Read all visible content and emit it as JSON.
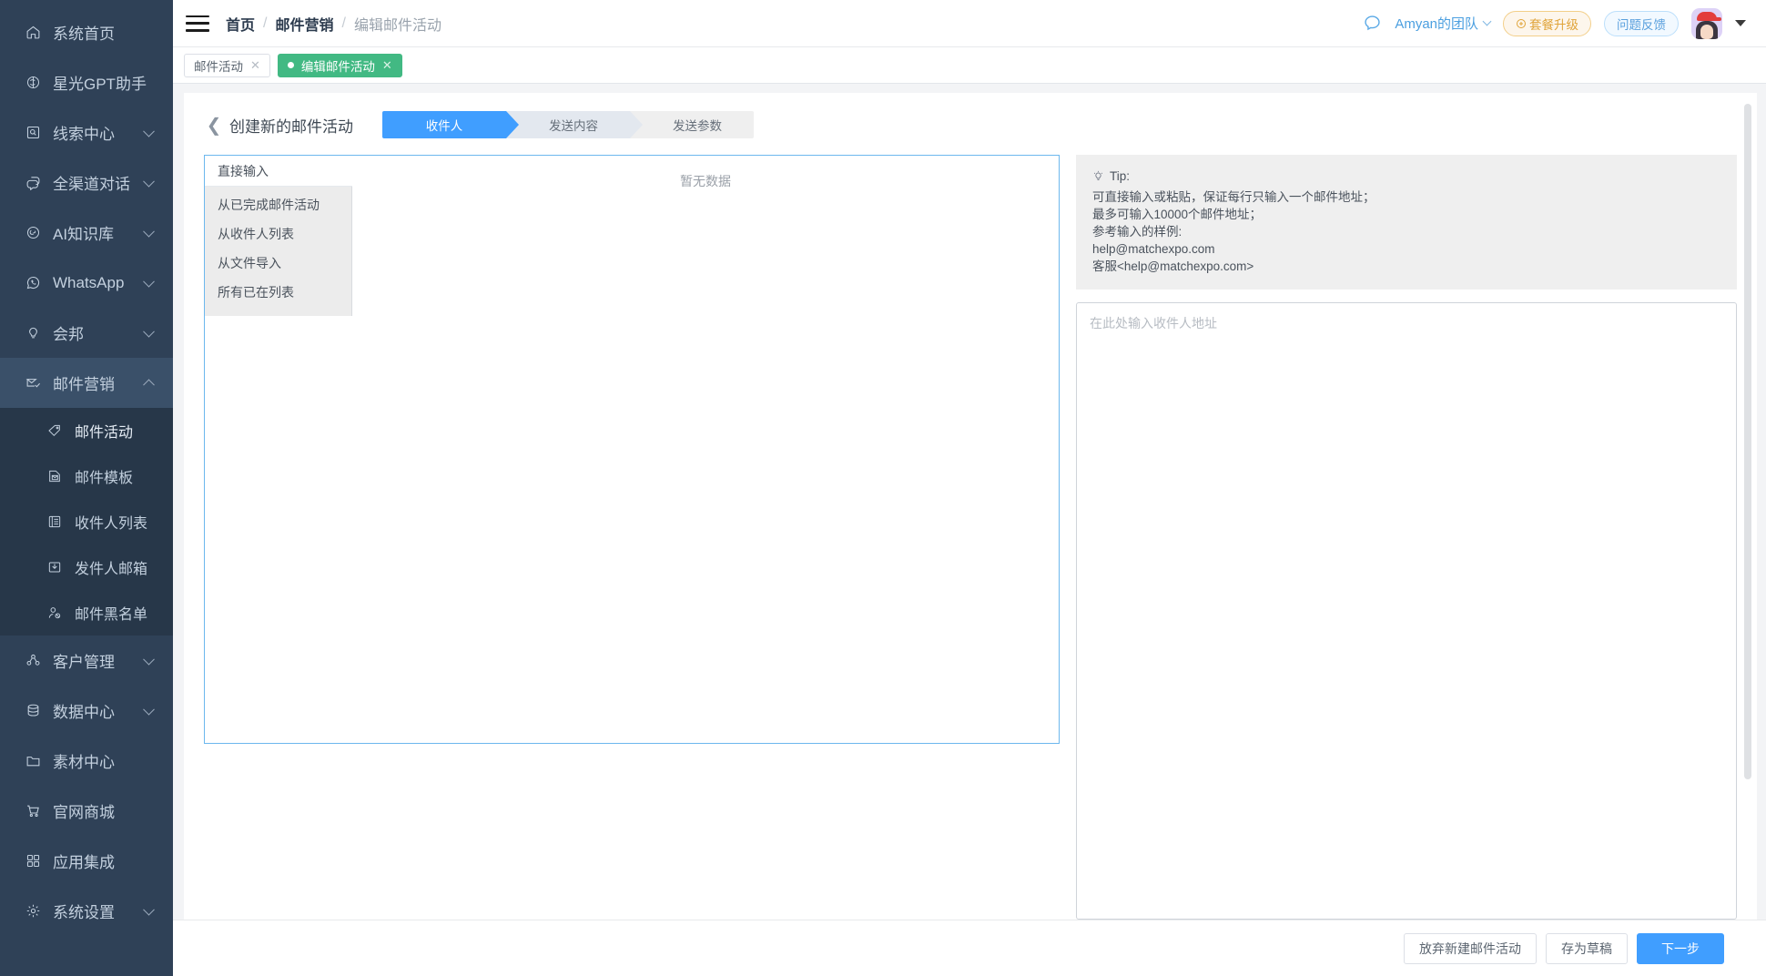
{
  "sidebar": {
    "items": [
      {
        "icon": "home-icon",
        "label": "系统首页",
        "chevron": false
      },
      {
        "icon": "gpt-icon",
        "label": "星光GPT助手",
        "chevron": false
      },
      {
        "icon": "clue-icon",
        "label": "线索中心",
        "chevron": true
      },
      {
        "icon": "chat-icon",
        "label": "全渠道对话",
        "chevron": true
      },
      {
        "icon": "ai-brain-icon",
        "label": "AI知识库",
        "chevron": true
      },
      {
        "icon": "whatsapp-icon",
        "label": "WhatsApp",
        "chevron": true
      },
      {
        "icon": "bulb-icon",
        "label": "会邦",
        "chevron": true
      }
    ],
    "expanded": {
      "icon": "mail-send-icon",
      "label": "邮件营销",
      "children": [
        {
          "icon": "tag-icon",
          "label": "邮件活动"
        },
        {
          "icon": "template-icon",
          "label": "邮件模板"
        },
        {
          "icon": "list-icon",
          "label": "收件人列表"
        },
        {
          "icon": "inbox-icon",
          "label": "发件人邮箱"
        },
        {
          "icon": "user-block-icon",
          "label": "邮件黑名单"
        }
      ]
    },
    "items_after": [
      {
        "icon": "customers-icon",
        "label": "客户管理",
        "chevron": true
      },
      {
        "icon": "database-icon",
        "label": "数据中心",
        "chevron": true
      },
      {
        "icon": "folder-icon",
        "label": "素材中心",
        "chevron": false
      },
      {
        "icon": "cart-icon",
        "label": "官网商城",
        "chevron": false
      },
      {
        "icon": "apps-icon",
        "label": "应用集成",
        "chevron": false
      },
      {
        "icon": "gear-icon",
        "label": "系统设置",
        "chevron": true
      }
    ]
  },
  "header": {
    "menu_icon": "hamburger-icon",
    "breadcrumb": [
      "首页",
      "邮件营销",
      "编辑邮件活动"
    ],
    "separator": "/",
    "chat_icon": "message-bubble-icon",
    "team": "Amyan的团队",
    "upgrade_label": "套餐升级",
    "upgrade_icon": "plus-circle-icon",
    "feedback_label": "问题反馈",
    "avatar": "user-avatar",
    "avatar_caret": "caret-down-icon"
  },
  "tabs": [
    {
      "label": "邮件活动",
      "active": false,
      "closable": true
    },
    {
      "label": "编辑邮件活动",
      "active": true,
      "closable": true
    }
  ],
  "page": {
    "back_icon": "chevron-left-icon",
    "title": "创建新的邮件活动",
    "steps": [
      {
        "label": "收件人",
        "state": "active"
      },
      {
        "label": "发送内容",
        "state": "next"
      },
      {
        "label": "发送参数",
        "state": "idle"
      }
    ]
  },
  "recipient_source": {
    "selected": "直接输入",
    "options": [
      "从已完成邮件活动",
      "从收件人列表",
      "从文件导入",
      "所有已在列表"
    ]
  },
  "recipient_table": {
    "empty_text": "暂无数据"
  },
  "tip": {
    "icon": "lightbulb-icon",
    "title": "Tip:",
    "lines": [
      "可直接输入或粘贴，保证每行只输入一个邮件地址；",
      "最多可输入10000个邮件地址；",
      "参考输入的样例:",
      "help@matchexpo.com",
      "客服<help@matchexpo.com>"
    ]
  },
  "mail_input": {
    "placeholder": "在此处输入收件人地址",
    "value": ""
  },
  "footer": {
    "discard_label": "放弃新建邮件活动",
    "draft_label": "存为草稿",
    "next_label": "下一步"
  },
  "colors": {
    "sidebar_bg": "#2f4157",
    "submenu_bg": "#273749",
    "accent_blue": "#409eff",
    "tab_green": "#42b983",
    "panel_border_blue": "#6cb8ee",
    "tip_bg": "#efefef",
    "upgrade_orange": "#e0a43a"
  }
}
